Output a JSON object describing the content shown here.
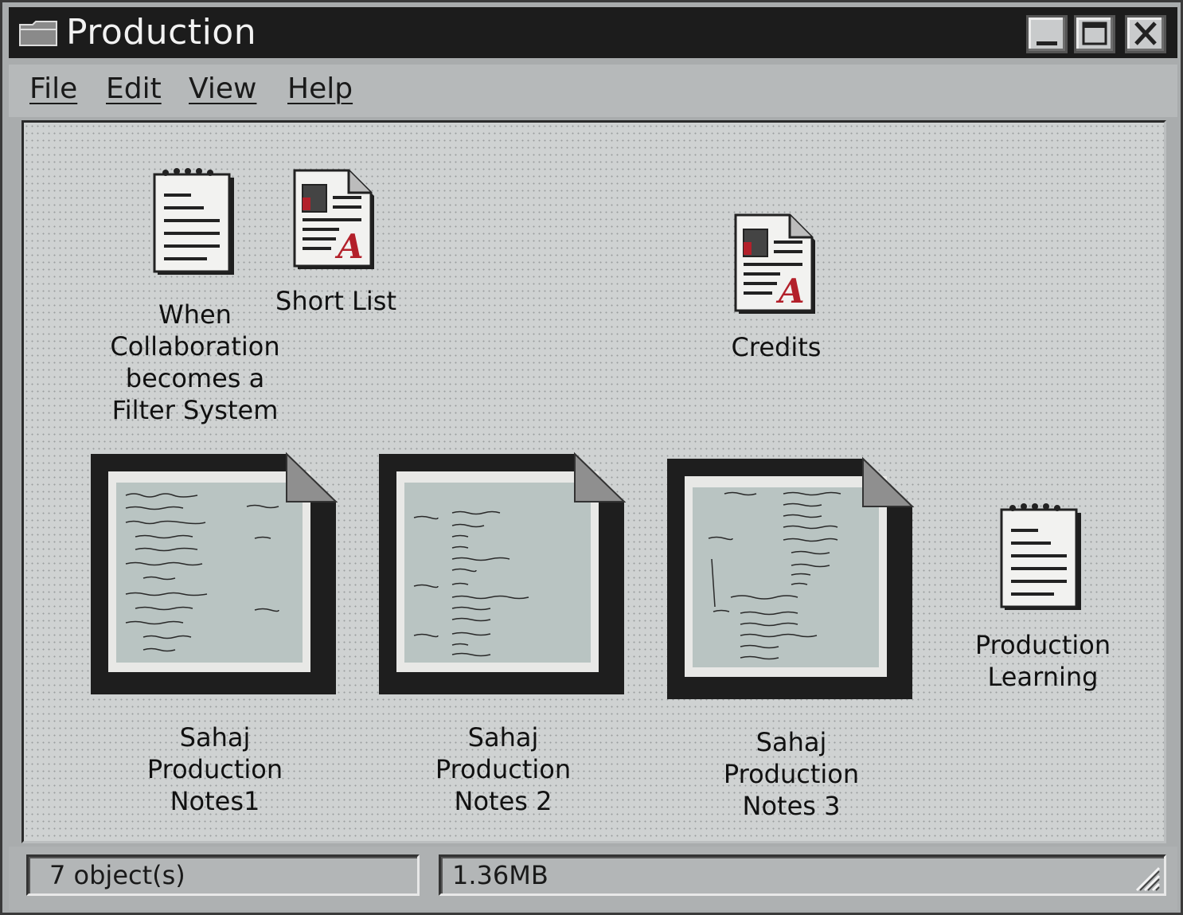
{
  "window": {
    "title": "Production"
  },
  "menu": {
    "items": [
      "File",
      "Edit",
      "View",
      "Help"
    ]
  },
  "icons": [
    {
      "label": "When Collaboration becomes a Filter System",
      "icon": "notepad-icon"
    },
    {
      "label": "Short List",
      "icon": "acrobat-document-icon"
    },
    {
      "label": "Credits",
      "icon": "acrobat-document-icon"
    },
    {
      "label": "Sahaj Production Notes1",
      "icon": "image-thumbnail-icon"
    },
    {
      "label": "Sahaj Production Notes 2",
      "icon": "image-thumbnail-icon"
    },
    {
      "label": "Sahaj Production Notes 3",
      "icon": "image-thumbnail-icon"
    },
    {
      "label": "Production Learning",
      "icon": "notepad-icon"
    }
  ],
  "status": {
    "objects": "7 object(s)",
    "size": "1.36MB"
  },
  "colors": {
    "titlebar": "#1c1c1c",
    "accent_red": "#b3202a"
  }
}
